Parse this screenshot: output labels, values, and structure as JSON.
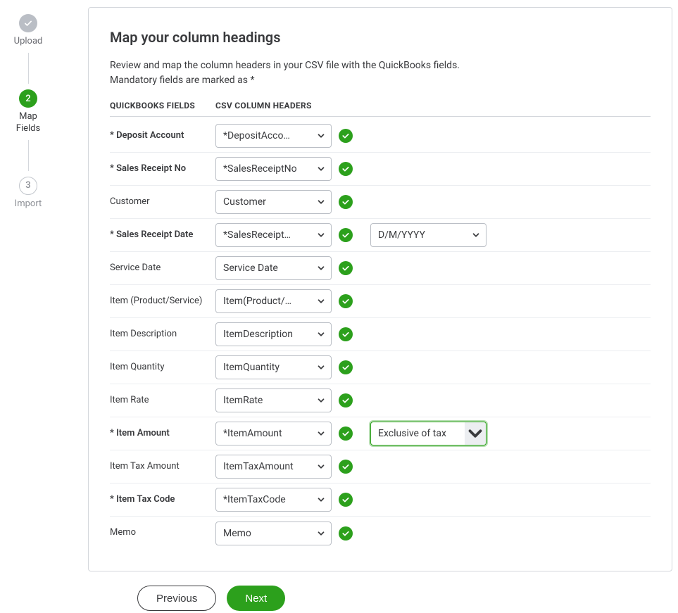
{
  "steps": {
    "step1": {
      "label": "Upload"
    },
    "step2": {
      "number": "2",
      "label": "Map\nFields"
    },
    "step3": {
      "number": "3",
      "label": "Import"
    }
  },
  "heading": "Map your column headings",
  "description_line1": "Review and map the column headers in your CSV file with the QuickBooks fields.",
  "description_line2": "Mandatory fields are marked as *",
  "table": {
    "header_col1": "QUICKBOOKS FIELDS",
    "header_col2": "CSV COLUMN HEADERS"
  },
  "fields": [
    {
      "label": "* Deposit Account",
      "required": true,
      "value": "*DepositAcco…",
      "extra": null
    },
    {
      "label": "* Sales Receipt No",
      "required": true,
      "value": "*SalesReceiptNo",
      "extra": null
    },
    {
      "label": "Customer",
      "required": false,
      "value": "Customer",
      "extra": null
    },
    {
      "label": "* Sales Receipt Date",
      "required": true,
      "value": "*SalesReceipt…",
      "extra": {
        "value": "D/M/YYYY",
        "focused": false
      }
    },
    {
      "label": "Service Date",
      "required": false,
      "value": "Service Date",
      "extra": null
    },
    {
      "label": "Item (Product/Service)",
      "required": false,
      "value": "Item(Product/…",
      "extra": null
    },
    {
      "label": "Item Description",
      "required": false,
      "value": "ItemDescription",
      "extra": null
    },
    {
      "label": "Item Quantity",
      "required": false,
      "value": "ItemQuantity",
      "extra": null
    },
    {
      "label": "Item Rate",
      "required": false,
      "value": "ItemRate",
      "extra": null
    },
    {
      "label": "* Item Amount",
      "required": true,
      "value": "*ItemAmount",
      "extra": {
        "value": "Exclusive of tax",
        "focused": true
      }
    },
    {
      "label": "Item Tax Amount",
      "required": false,
      "value": "ItemTaxAmount",
      "extra": null
    },
    {
      "label": "* Item Tax Code",
      "required": true,
      "value": "*ItemTaxCode",
      "extra": null
    },
    {
      "label": "Memo",
      "required": false,
      "value": "Memo",
      "extra": null
    }
  ],
  "buttons": {
    "previous": "Previous",
    "next": "Next"
  }
}
